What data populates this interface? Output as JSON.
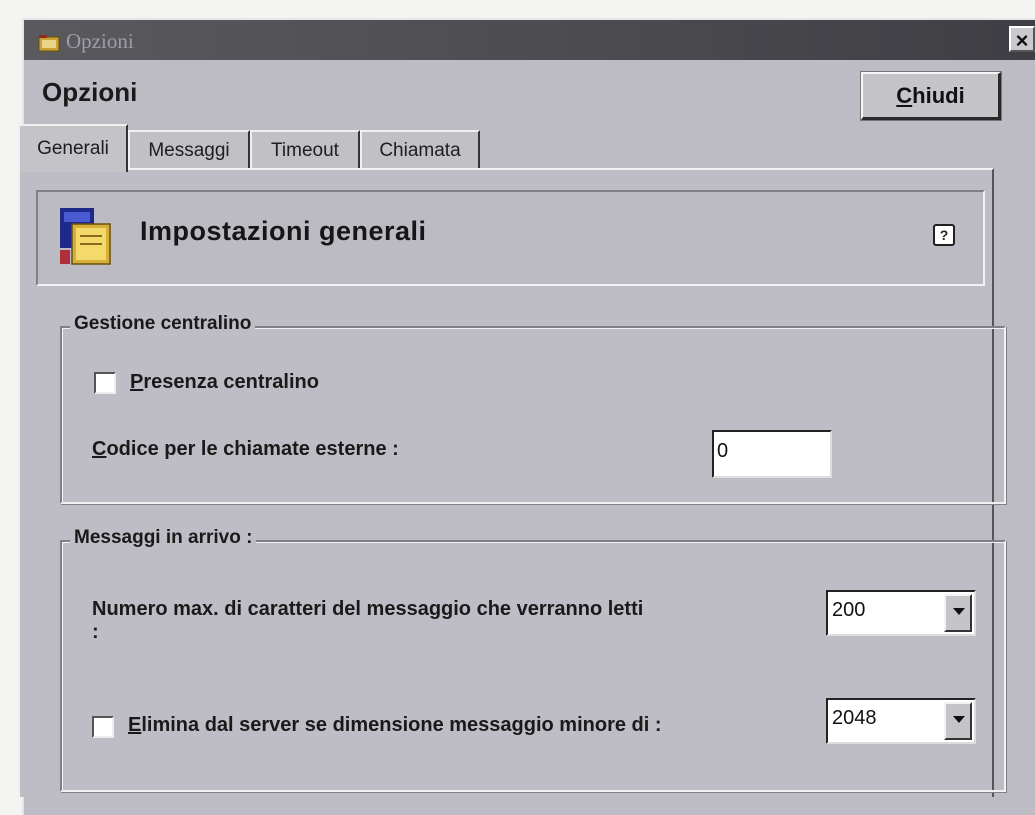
{
  "window": {
    "title": "Opzioni",
    "close_glyph": "×",
    "icon": "window-app-icon"
  },
  "header": {
    "title": "Opzioni",
    "close_button_label": "Chiudi",
    "close_button_accel": "C",
    "close_button_rest": "hiudi"
  },
  "tabs": [
    {
      "label": "Generali",
      "active": true
    },
    {
      "label": "Messaggi",
      "active": false
    },
    {
      "label": "Timeout",
      "active": false
    },
    {
      "label": "Chiamata",
      "active": false
    }
  ],
  "banner": {
    "title": "Impostazioni generali",
    "icon": "settings-document-icon",
    "help_icon": "?"
  },
  "group_centralino": {
    "legend": "Gestione centralino",
    "presence_checkbox": {
      "accel": "P",
      "rest": "resenza centralino",
      "checked": false
    },
    "external_code": {
      "accel": "C",
      "rest": "odice per le chiamate esterne :",
      "value": "0"
    }
  },
  "group_messages": {
    "legend": "Messaggi in arrivo :",
    "max_chars": {
      "label_line1": "Numero max. di caratteri del messaggio che verranno letti",
      "label_line2": ":",
      "value": "200"
    },
    "delete_checkbox": {
      "accel": "E",
      "rest": "limina dal server se dimensione messaggio minore di :",
      "checked": false,
      "value": "2048"
    }
  },
  "colors": {
    "dialog_bg": "#bdbcc4",
    "titlebar": "#4a4a4f"
  }
}
